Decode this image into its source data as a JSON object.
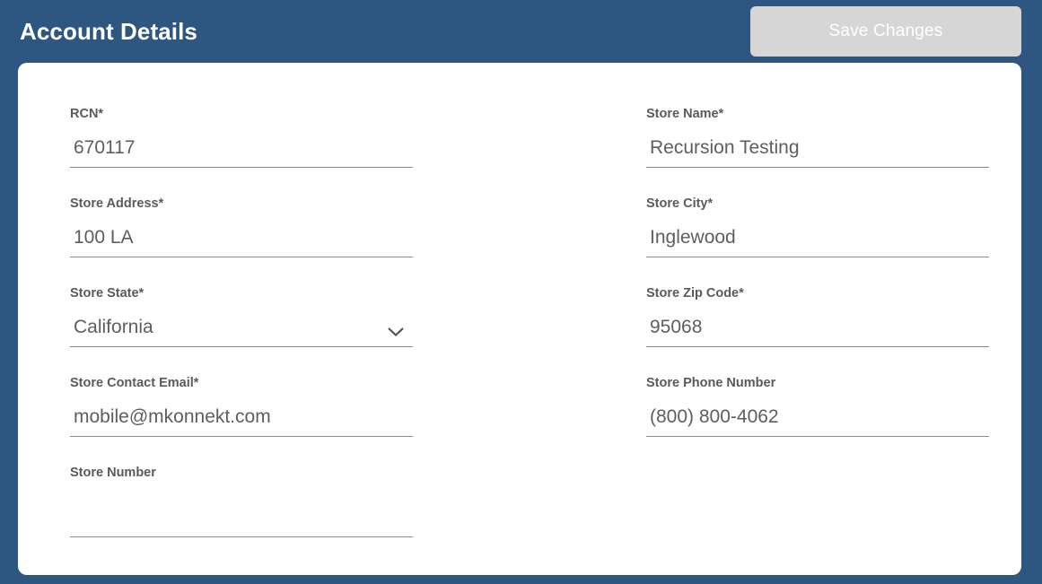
{
  "header": {
    "title": "Account Details",
    "save_button_label": "Save Changes",
    "save_button_state": "disabled",
    "background_color": "#2d5680",
    "save_button_color": "#d6d6d6"
  },
  "card": {
    "background_color": "#ffffff"
  },
  "form": {
    "fields": [
      {
        "name": "rcn",
        "label": "RCN*",
        "value": "670117",
        "placeholder": "",
        "type": "text",
        "column": "left",
        "row": 1
      },
      {
        "name": "store-name",
        "label": "Store Name*",
        "value": "Recursion Testing",
        "placeholder": "",
        "type": "text",
        "column": "right",
        "row": 1
      },
      {
        "name": "store-address",
        "label": "Store Address*",
        "value": "100 LA",
        "placeholder": "",
        "type": "text",
        "column": "left",
        "row": 2
      },
      {
        "name": "store-city",
        "label": "Store City*",
        "value": "Inglewood",
        "placeholder": "",
        "type": "text",
        "column": "right",
        "row": 2
      },
      {
        "name": "store-state",
        "label": "Store State*",
        "value": "California",
        "placeholder": "",
        "type": "select",
        "icon": "chevron-down-icon",
        "column": "left",
        "row": 3
      },
      {
        "name": "store-zip-code",
        "label": "Store Zip Code*",
        "value": "95068",
        "placeholder": "",
        "type": "text",
        "column": "right",
        "row": 3
      },
      {
        "name": "store-contact-email",
        "label": "Store Contact Email*",
        "value": "mobile@mkonnekt.com",
        "placeholder": "",
        "type": "email",
        "column": "left",
        "row": 4
      },
      {
        "name": "store-phone-number",
        "label": "Store Phone Number",
        "value": "(800) 800-4062",
        "placeholder": "",
        "type": "tel",
        "column": "right",
        "row": 4
      },
      {
        "name": "store-number",
        "label": "Store Number",
        "value": "",
        "placeholder": "",
        "type": "text",
        "column": "left",
        "row": 5
      }
    ]
  }
}
